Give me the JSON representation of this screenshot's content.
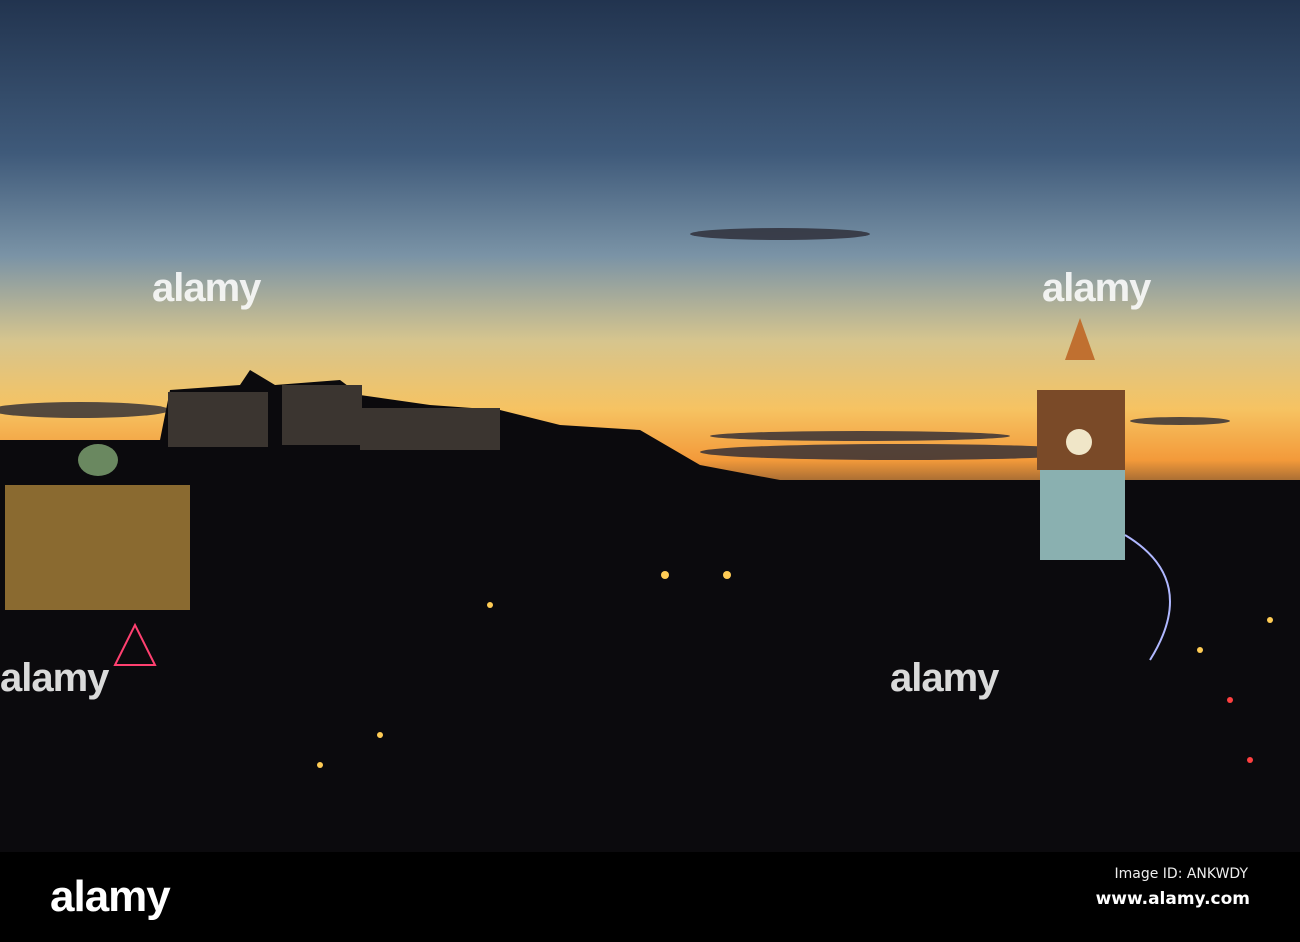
{
  "watermark": {
    "logo": "alamy",
    "image_id": "Image ID: ANKWDY",
    "site": "www.alamy.com"
  },
  "colors": {
    "sky_top": "#22344f",
    "sky_mid": "#6a86a3",
    "sky_low": "#f3c56a",
    "horizon": "#f29a3a",
    "silhouette": "#0b0a0d"
  }
}
